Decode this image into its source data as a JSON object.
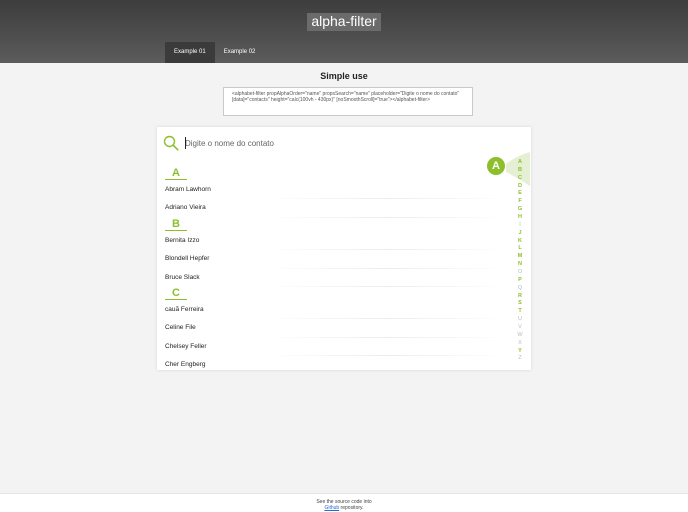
{
  "header": {
    "title": "alpha-filter",
    "tabs": [
      {
        "label": "Example 01"
      },
      {
        "label": "Example 02"
      }
    ]
  },
  "main": {
    "heading": "Simple use",
    "code_snippet": "<alphabet-filter propAlphaOrder=\"name\" propsSearch=\"name\" placeholder=\"Digite o nome do contato\" [data]=\"contacts\" height=\"calc(100vh - 430px)\" [noSmoothScroll]=\"true\"></alphabet-filter>"
  },
  "filter": {
    "search_placeholder": "Digite o nome do contato",
    "active_letter": "A",
    "groups": [
      {
        "letter": "A",
        "items": [
          "Abram Lawhorn",
          "Adriano Vieira"
        ]
      },
      {
        "letter": "B",
        "items": [
          "Bernita Izzo",
          "Blondell Hepfer",
          "Bruce Slack"
        ]
      },
      {
        "letter": "C",
        "items": [
          "cauã Ferreira",
          "Celine File",
          "Chelsey Feller",
          "Cher Engberg"
        ]
      }
    ],
    "alphabet": [
      {
        "l": "A",
        "on": true
      },
      {
        "l": "B",
        "on": true
      },
      {
        "l": "C",
        "on": true
      },
      {
        "l": "D",
        "on": true
      },
      {
        "l": "E",
        "on": true
      },
      {
        "l": "F",
        "on": true
      },
      {
        "l": "G",
        "on": true
      },
      {
        "l": "H",
        "on": true
      },
      {
        "l": "I",
        "on": false
      },
      {
        "l": "J",
        "on": true
      },
      {
        "l": "K",
        "on": true
      },
      {
        "l": "L",
        "on": true
      },
      {
        "l": "M",
        "on": true
      },
      {
        "l": "N",
        "on": true
      },
      {
        "l": "O",
        "on": false
      },
      {
        "l": "P",
        "on": true
      },
      {
        "l": "Q",
        "on": false
      },
      {
        "l": "R",
        "on": true
      },
      {
        "l": "S",
        "on": true
      },
      {
        "l": "T",
        "on": true
      },
      {
        "l": "U",
        "on": false
      },
      {
        "l": "V",
        "on": false
      },
      {
        "l": "W",
        "on": false
      },
      {
        "l": "X",
        "on": false
      },
      {
        "l": "Y",
        "on": true
      },
      {
        "l": "Z",
        "on": false
      }
    ],
    "accent_color": "#8bbf2b",
    "search_icon": "search-icon"
  },
  "footer": {
    "line1": "See the source code into",
    "link_label": "Github",
    "line2_suffix": " repository."
  }
}
